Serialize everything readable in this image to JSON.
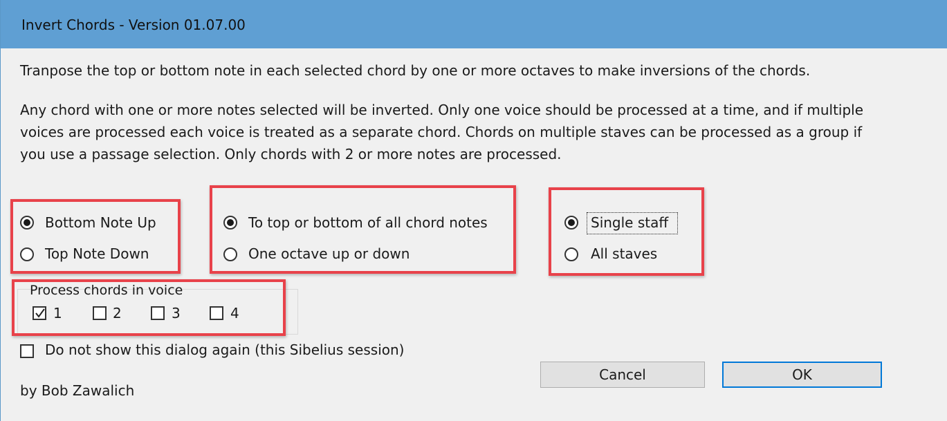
{
  "window": {
    "title": "Invert Chords - Version 01.07.00"
  },
  "description": {
    "line1": "Tranpose the top or bottom note in each selected chord by one or more octaves to make inversions of the chords.",
    "para2": [
      "Any chord with one or more notes selected will be inverted. Only one voice should be processed at a time, and if multiple",
      "voices are processed each voice is treated as a separate chord. Chords on multiple staves can be processed as a group if",
      "you use a passage selection. Only chords with 2 or more notes are processed."
    ]
  },
  "direction_group": {
    "options": [
      {
        "label": "Bottom Note Up",
        "selected": true
      },
      {
        "label": "Top Note Down",
        "selected": false
      }
    ]
  },
  "distance_group": {
    "options": [
      {
        "label": "To top or bottom of all chord notes",
        "selected": true
      },
      {
        "label": "One octave up or down",
        "selected": false
      }
    ]
  },
  "staff_group": {
    "options": [
      {
        "label": "Single staff",
        "selected": true
      },
      {
        "label": "All staves",
        "selected": false
      }
    ]
  },
  "voice_group": {
    "label": "Process chords in voice",
    "voices": [
      {
        "label": "1",
        "checked": true
      },
      {
        "label": "2",
        "checked": false
      },
      {
        "label": "3",
        "checked": false
      },
      {
        "label": "4",
        "checked": false
      }
    ]
  },
  "dont_show": {
    "label": "Do not show this dialog again (this Sibelius session)",
    "checked": false
  },
  "credit": "by Bob Zawalich",
  "buttons": {
    "cancel": "Cancel",
    "ok": "OK"
  },
  "colors": {
    "titlebar": "#5f9fd3",
    "highlight_box": "#e8424a",
    "default_button_border": "#0078d7"
  }
}
